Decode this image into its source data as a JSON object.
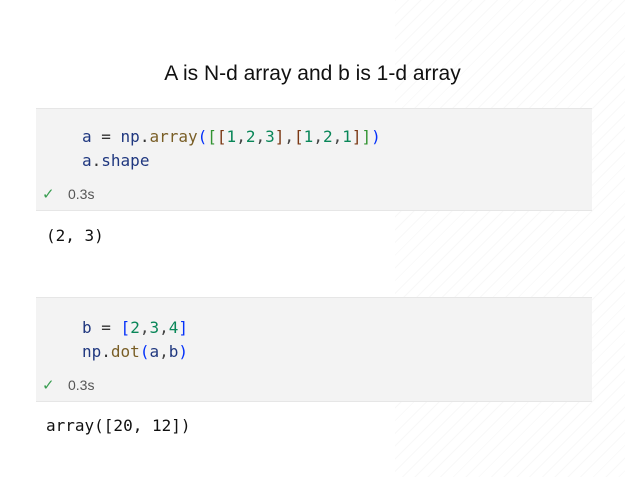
{
  "slide": {
    "title": "A is N-d array and b is 1-d array"
  },
  "cells": [
    {
      "code_lines": [
        "a = np.array([[1,2,3],[1,2,1]])",
        "a.shape"
      ],
      "status_icon": "check-icon",
      "exec_time": "0.3s",
      "output": "(2, 3)"
    },
    {
      "code_lines": [
        "b = [2,3,4]",
        "np.dot(a,b)"
      ],
      "status_icon": "check-icon",
      "exec_time": "0.3s",
      "output": "array([20, 12])"
    }
  ],
  "colors": {
    "variable": "#1f377f",
    "function": "#795e26",
    "number": "#098658",
    "bracket_1": "#0431fa",
    "bracket_2": "#319331",
    "bracket_3": "#7b3814",
    "success": "#3a9e52",
    "cell_background": "#f3f3f3"
  }
}
